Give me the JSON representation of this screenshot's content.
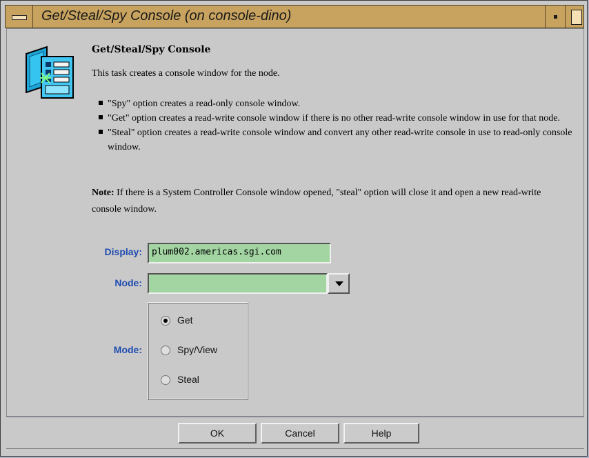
{
  "window": {
    "title": "Get/Steal/Spy Console (on console-dino)"
  },
  "dialog": {
    "heading": "Get/Steal/Spy Console",
    "description": "This task creates a console window for the node.",
    "bullets": [
      "\"Spy\" option creates a read-only console window.",
      "\"Get\" option creates a read-write console window if there is no other read-write console window in use for that node.",
      "\"Steal\" option creates a read-write console window and convert any other read-write console in use to read-only console window."
    ],
    "note_label": "Note:",
    "note_text": " If there is a System Controller Console window opened, \"steal\" option will close it and open a new read-write console window."
  },
  "form": {
    "display_label": "Display:",
    "display_value": "plum002.americas.sgi.com",
    "node_label": "Node:",
    "node_value": "",
    "mode_label": "Mode:",
    "mode_options": [
      "Get",
      "Spy/View",
      "Steal"
    ],
    "mode_selected": "Get"
  },
  "buttons": {
    "ok": "OK",
    "cancel": "Cancel",
    "help": "Help"
  },
  "colors": {
    "titlebar": "#c8a35f",
    "field_bg": "#a3d5a3",
    "label_blue": "#1e4bb0",
    "window_bg": "#c9c9c9"
  },
  "icons": {
    "window_menu": "window-menu-icon",
    "minimize": "minimize-icon",
    "maximize": "maximize-icon",
    "task": "console-task-icon",
    "dropdown": "triangle-down-icon"
  }
}
